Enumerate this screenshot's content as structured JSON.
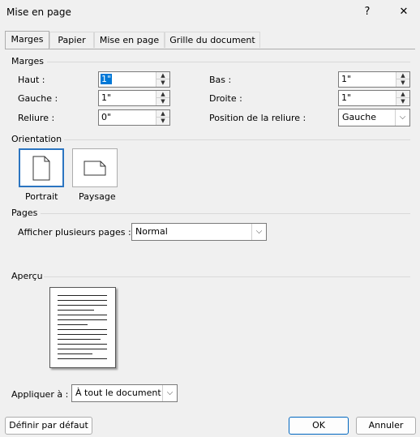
{
  "window": {
    "title": "Mise en page",
    "help_label": "?",
    "close_label": "✕"
  },
  "tabs": [
    {
      "label": "Marges"
    },
    {
      "label": "Papier"
    },
    {
      "label": "Mise en page"
    },
    {
      "label": "Grille du document"
    }
  ],
  "margins": {
    "section_label": "Marges",
    "haut_label": "Haut :",
    "haut_value": "1\"",
    "gauche_label": "Gauche :",
    "gauche_value": "1\"",
    "reliure_label": "Reliure :",
    "reliure_value": "0\"",
    "bas_label": "Bas :",
    "bas_value": "1\"",
    "droite_label": "Droite :",
    "droite_value": "1\"",
    "position_reliure_label": "Position de la reliure :",
    "position_reliure_value": "Gauche"
  },
  "orientation": {
    "section_label": "Orientation",
    "portrait_label": "Portrait",
    "paysage_label": "Paysage"
  },
  "pages": {
    "section_label": "Pages",
    "afficher_label": "Afficher plusieurs pages :",
    "afficher_value": "Normal"
  },
  "apercu": {
    "section_label": "Aperçu",
    "appliquer_label": "Appliquer à :",
    "appliquer_value": "À tout le document"
  },
  "footer": {
    "default_label": "Définir par défaut",
    "ok_label": "OK",
    "cancel_label": "Annuler"
  }
}
